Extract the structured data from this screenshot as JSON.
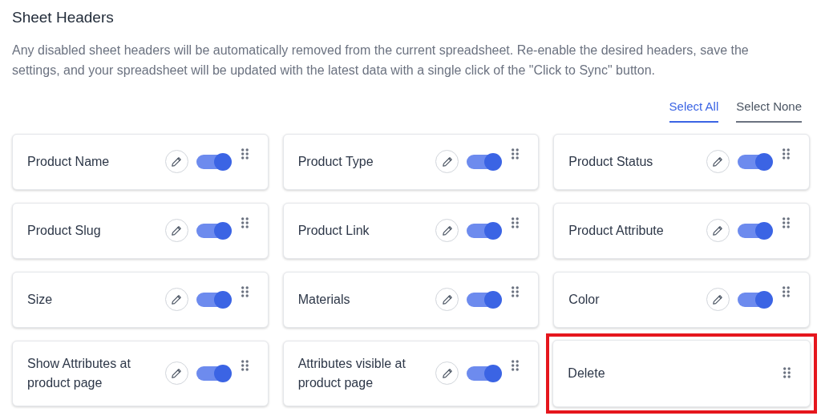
{
  "title": "Sheet Headers",
  "description": "Any disabled sheet headers will be automatically removed from the current spreadsheet. Re-enable the desired headers, save the settings, and your spreadsheet will be updated with the latest data with a single click of the \"Click to Sync\" button.",
  "selection_links": [
    {
      "label": "Select All",
      "selected": true
    },
    {
      "label": "Select None",
      "selected": false
    }
  ],
  "headers": [
    {
      "kind": "toggle",
      "label": "Product Name",
      "on": true,
      "highlighted": false
    },
    {
      "kind": "toggle",
      "label": "Product Type",
      "on": true,
      "highlighted": false
    },
    {
      "kind": "toggle",
      "label": "Product Status",
      "on": true,
      "highlighted": false
    },
    {
      "kind": "toggle",
      "label": "Product Slug",
      "on": true,
      "highlighted": false
    },
    {
      "kind": "toggle",
      "label": "Product Link",
      "on": true,
      "highlighted": false
    },
    {
      "kind": "toggle",
      "label": "Product Attribute",
      "on": true,
      "highlighted": false
    },
    {
      "kind": "toggle",
      "label": "Size",
      "on": true,
      "highlighted": false
    },
    {
      "kind": "toggle",
      "label": "Materials",
      "on": true,
      "highlighted": false
    },
    {
      "kind": "toggle",
      "label": "Color",
      "on": true,
      "highlighted": false
    },
    {
      "kind": "toggle",
      "label": "Show Attributes at product page",
      "on": true,
      "highlighted": false
    },
    {
      "kind": "toggle",
      "label": "Attributes visible at product page",
      "on": true,
      "highlighted": false
    },
    {
      "kind": "fixed",
      "label": "Delete",
      "highlighted": true
    }
  ]
}
